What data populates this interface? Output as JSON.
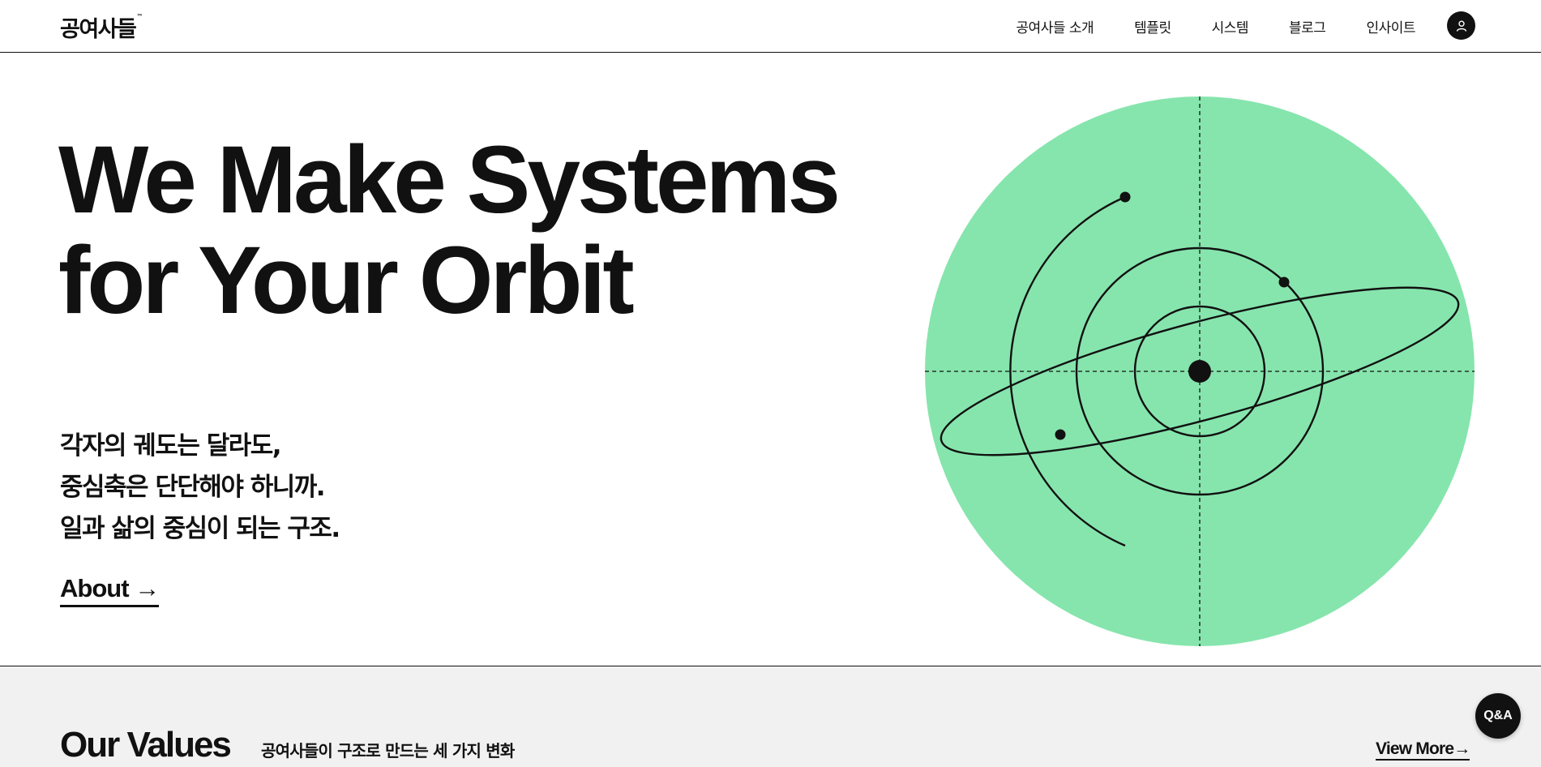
{
  "header": {
    "logo": "공여사들",
    "logo_mark": "™",
    "nav": [
      "공여사들 소개",
      "템플릿",
      "시스템",
      "블로그",
      "인사이트"
    ],
    "user_icon": "user-icon"
  },
  "hero": {
    "title_line1": "We Make Systems",
    "title_line2": "for Your Orbit",
    "sub_line1": "각자의 궤도는 달라도,",
    "sub_line2": "중심축은 단단해야 하니까.",
    "sub_line3": "일과 삶의 중심이 되는 구조.",
    "about_label": "About →",
    "illustration_color": "#86e5ad"
  },
  "values": {
    "title": "Our Values",
    "subtitle": "공여사들이 구조로 만드는 세 가지 변화",
    "view_more": "View More→"
  },
  "qa_button": "Q&A"
}
